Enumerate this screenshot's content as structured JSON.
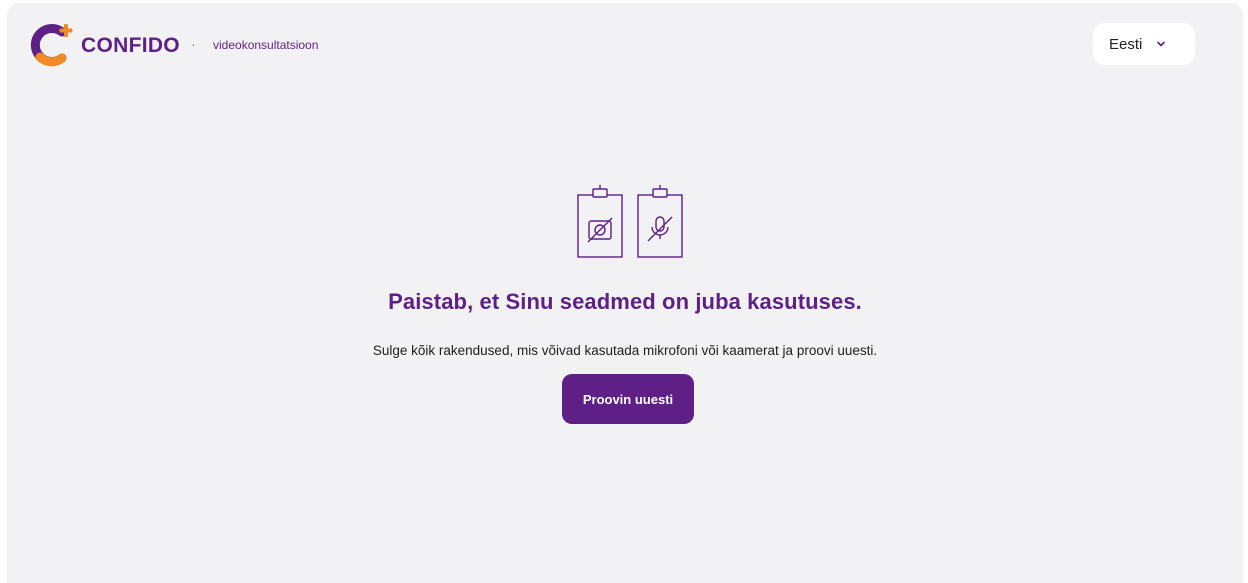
{
  "header": {
    "brand_name": "CONFIDO",
    "separator": "·",
    "subtitle": "videokonsultatsioon",
    "language": {
      "selected": "Eesti",
      "icon": "chevron-down-icon"
    }
  },
  "main": {
    "illustration_icons": [
      "camera-off-clipboard-icon",
      "microphone-off-clipboard-icon"
    ],
    "title": "Paistab, et Sinu seadmed on juba kasutuses.",
    "message": "Sulge kõik rakendused, mis võivad kasutada mikrofoni või kaamerat ja proovi uuesti.",
    "retry_label": "Proovin uuesti"
  },
  "colors": {
    "brand_purple": "#5e1f86",
    "brand_orange": "#f08a24",
    "background": "#f2f2f4",
    "button_bg": "#5e1f86"
  }
}
